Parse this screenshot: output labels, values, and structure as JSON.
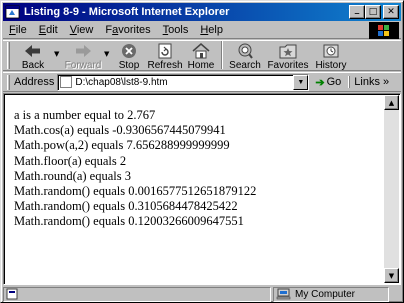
{
  "window": {
    "title": "Listing 8-9 - Microsoft Internet Explorer"
  },
  "title_buttons": {
    "minimize": "_",
    "maximize": "□",
    "close": "✕"
  },
  "menu": [
    {
      "u": "F",
      "rest": "ile"
    },
    {
      "u": "E",
      "rest": "dit"
    },
    {
      "u": "V",
      "rest": "iew"
    },
    {
      "u": "",
      "rest": "Favorites",
      "u_inner": "a"
    },
    {
      "u": "T",
      "rest": "ools"
    },
    {
      "u": "H",
      "rest": "elp"
    }
  ],
  "toolbar": {
    "back": "Back",
    "forward": "Forward",
    "stop": "Stop",
    "refresh": "Refresh",
    "home": "Home",
    "search": "Search",
    "favorites": "Favorites",
    "history": "History"
  },
  "address": {
    "label": "Address",
    "value": "D:\\chap08\\lst8-9.htm",
    "go": "Go",
    "links": "Links »"
  },
  "content": {
    "lines": [
      "a is a number equal to 2.767",
      "Math.cos(a) equals -0.9306567445079941",
      "Math.pow(a,2) equals 7.656288999999999",
      "Math.floor(a) equals 2",
      "Math.round(a) equals 3",
      "Math.random() equals 0.0016577512651879122",
      "Math.random() equals 0.3105684478425422",
      "Math.random() equals 0.12003266009647551"
    ]
  },
  "status": {
    "zone": "My Computer"
  },
  "colors": {
    "titlebar_start": "#000080",
    "titlebar_end": "#1084d0",
    "chrome": "#c0c0c0"
  }
}
